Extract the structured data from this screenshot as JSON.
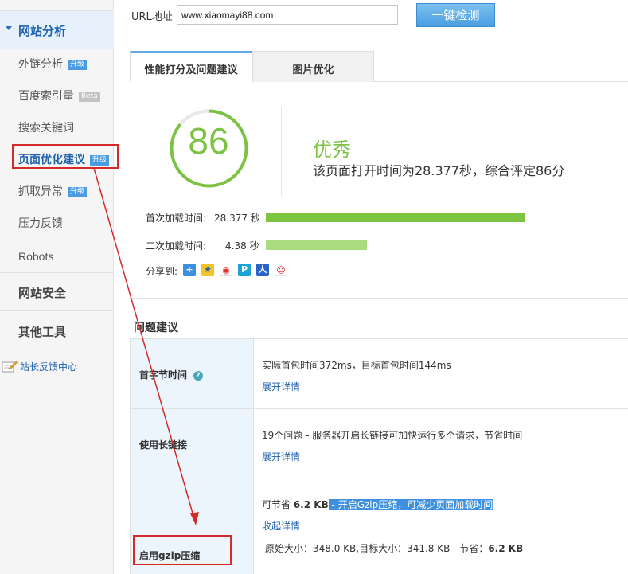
{
  "sidebar": {
    "header": "网站分析",
    "items": [
      {
        "label": "外链分析",
        "badge": "升级"
      },
      {
        "label": "百度索引量",
        "badge": "Beta"
      },
      {
        "label": "搜索关键词",
        "badge": ""
      },
      {
        "label": "页面优化建议",
        "badge": "升级"
      },
      {
        "label": "抓取异常",
        "badge": "升级"
      },
      {
        "label": "压力反馈",
        "badge": ""
      },
      {
        "label": "Robots",
        "badge": ""
      }
    ],
    "sections": [
      "网站安全",
      "其他工具"
    ],
    "feedback": "站长反馈中心"
  },
  "url_bar": {
    "label": "URL地址",
    "value": "www.xiaomayi88.com",
    "button": "一键检测"
  },
  "tabs": [
    "性能打分及问题建议",
    "图片优化"
  ],
  "score": {
    "value": "86",
    "grade": "优秀",
    "description": "该页面打开时间为28.377秒，综合评定86分"
  },
  "load_times": {
    "first_label": "首次加载时间:",
    "first_value": "28.377 秒",
    "first_seconds": 28.377,
    "second_label": "二次加载时间:",
    "second_value": "4.38 秒",
    "second_seconds": 4.38
  },
  "share": {
    "label": "分享到:",
    "icons": [
      "plus-share-icon",
      "qzone-icon",
      "weibo-icon",
      "tencent-weibo-icon",
      "baidu-icon",
      "renren-icon"
    ]
  },
  "issues": {
    "title": "问题建议",
    "rows": [
      {
        "name": "首字节时间",
        "desc": "实际首包时间372ms，目标首包时间144ms",
        "link": "展开详情"
      },
      {
        "name": "使用长链接",
        "desc": "19个问题 - 服务器开启长链接可加快运行多个请求，节省时间",
        "link": "展开详情"
      },
      {
        "name": "启用gzip压缩",
        "desc_prefix": "可节省 ",
        "desc_bold": "6.2 KB",
        "desc_sep": " - ",
        "desc_highlight": "开启Gzip压缩，可减少页面加载时间",
        "link": "收起详情",
        "detail_prefix": "原始大小：348.0 KB,目标大小：341.8 KB - 节省：",
        "detail_bold": "6.2 KB"
      }
    ]
  },
  "colors": {
    "accent": "#7cc243",
    "link": "#1f62ad",
    "annotation": "#d42a2a"
  }
}
